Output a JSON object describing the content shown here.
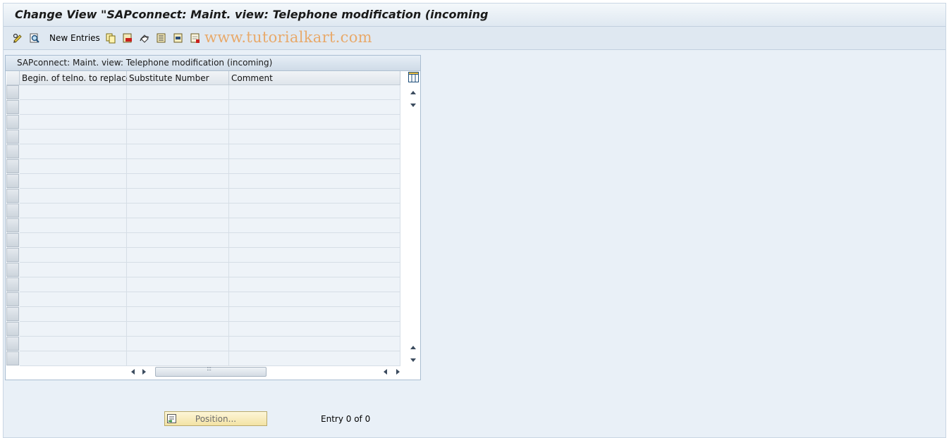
{
  "window": {
    "title": "Change View \"SAPconnect: Maint. view: Telephone modification (incoming"
  },
  "toolbar": {
    "new_entries_label": "New Entries",
    "watermark": "www.tutorialkart.com",
    "icons": [
      "display-change-icon",
      "find-icon",
      "copy-icon",
      "delete-icon",
      "undo-icon",
      "select-all-icon",
      "select-block-icon",
      "deselect-all-icon"
    ]
  },
  "table": {
    "title": "SAPconnect: Maint. view: Telephone modification (incoming)",
    "columns": [
      "Begin. of telno. to replace",
      "Substitute Number",
      "Comment"
    ],
    "rows": []
  },
  "footer": {
    "position_button_label": "Position...",
    "entry_text": "Entry 0 of 0"
  },
  "colors": {
    "background": "#e9f0f7",
    "grid_cell": "#eef3f8",
    "button_fill": "#f3e3a4",
    "watermark": "#e8a96a"
  }
}
